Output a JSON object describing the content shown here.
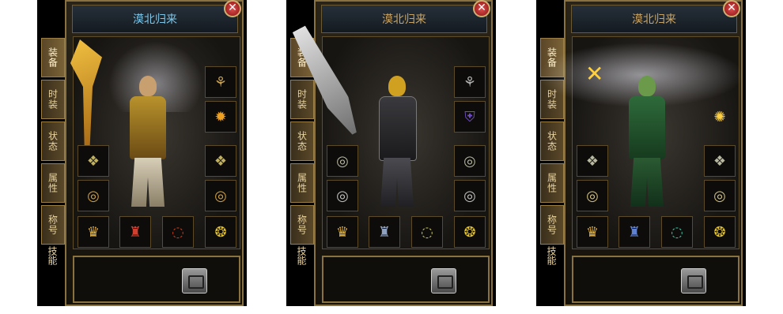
{
  "panels": [
    {
      "title": "漠北归来",
      "tabs": [
        "装备",
        "时装",
        "状态",
        "属性",
        "称号"
      ],
      "skill_tab": "技能",
      "close": "✕",
      "slot_icons": [
        "⚘",
        "✹",
        "❖",
        "❖",
        "◎",
        "◎",
        "♛",
        "♜",
        "◌",
        "❂"
      ]
    },
    {
      "title": "漠北归来",
      "tabs": [
        "装备",
        "时装",
        "状态",
        "属性",
        "称号"
      ],
      "skill_tab": "技能",
      "close": "✕",
      "slot_icons": [
        "⚘",
        "⛨",
        "◎",
        "◎",
        "◎",
        "◎",
        "♛",
        "♜",
        "◌",
        "❂"
      ]
    },
    {
      "title": "漠北归来",
      "tabs": [
        "装备",
        "时装",
        "状态",
        "属性",
        "称号"
      ],
      "skill_tab": "技能",
      "close": "✕",
      "slot_icons": [
        "✺",
        "❖",
        "❖",
        "◎",
        "◎",
        "♛",
        "♜",
        "◌",
        "❂"
      ]
    }
  ],
  "colors": {
    "title_blue": "#7fc6e8",
    "title_gold": "#c9a566",
    "frame_gold": "#8a7240"
  }
}
